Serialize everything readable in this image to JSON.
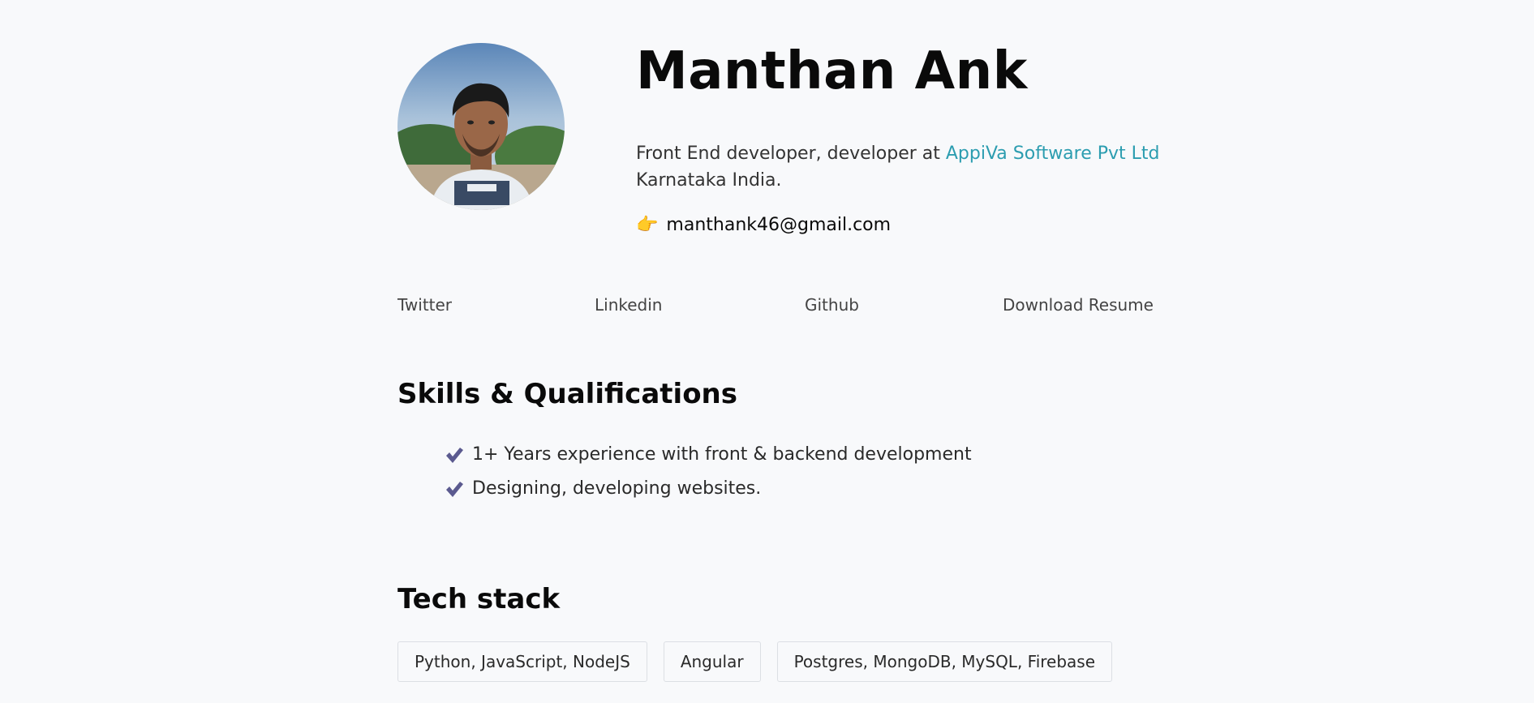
{
  "profile": {
    "name": "Manthan Ank",
    "bio_prefix": "Front End developer, developer at ",
    "company": "AppiVa Software Pvt Ltd",
    "location": "Karnataka India.",
    "email_emoji": "👉",
    "email": "manthank46@gmail.com"
  },
  "links": [
    {
      "label": "Twitter"
    },
    {
      "label": "Linkedin"
    },
    {
      "label": "Github"
    },
    {
      "label": "Download Resume"
    }
  ],
  "skills": {
    "title": "Skills & Qualifications",
    "items": [
      "1+ Years experience with front & backend development",
      "Designing, developing websites."
    ]
  },
  "tech": {
    "title": "Tech stack",
    "tags": [
      "Python, JavaScript, NodeJS",
      "Angular",
      "Postgres, MongoDB, MySQL, Firebase"
    ]
  },
  "colors": {
    "background": "#f8f9fb",
    "accent_link": "#2c9db0",
    "check": "#5b5a8f"
  },
  "icons": {
    "check": "check-icon",
    "pointer": "pointing-right-icon"
  }
}
